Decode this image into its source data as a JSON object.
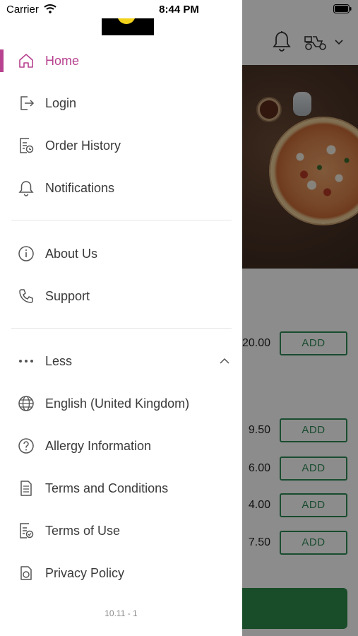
{
  "status_bar": {
    "carrier": "Carrier",
    "time": "8:44 PM"
  },
  "background": {
    "rows": [
      {
        "price": "20.00",
        "button": "ADD"
      },
      {
        "price": "9.50",
        "button": "ADD"
      },
      {
        "price": "6.00",
        "button": "ADD"
      },
      {
        "price": "4.00",
        "button": "ADD"
      },
      {
        "price": "7.50",
        "button": "ADD"
      }
    ],
    "accent_color": "#2e8b57"
  },
  "drawer": {
    "accent_color": "#b7428f",
    "section1": [
      {
        "label": "Home",
        "icon": "home-icon",
        "active": true
      },
      {
        "label": "Login",
        "icon": "login-icon",
        "active": false
      },
      {
        "label": "Order History",
        "icon": "order-history-icon",
        "active": false
      },
      {
        "label": "Notifications",
        "icon": "bell-icon",
        "active": false
      }
    ],
    "section2": [
      {
        "label": "About Us",
        "icon": "info-icon"
      },
      {
        "label": "Support",
        "icon": "phone-icon"
      }
    ],
    "section3": [
      {
        "label": "Less",
        "icon": "more-dots-icon"
      },
      {
        "label": "English (United Kingdom)",
        "icon": "globe-icon"
      },
      {
        "label": "Allergy Information",
        "icon": "question-icon"
      },
      {
        "label": "Terms and Conditions",
        "icon": "document-icon"
      },
      {
        "label": "Terms of Use",
        "icon": "document-check-icon"
      },
      {
        "label": "Privacy Policy",
        "icon": "privacy-icon"
      }
    ],
    "version": "10.11 - 1"
  }
}
